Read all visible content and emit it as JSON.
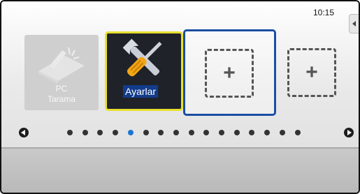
{
  "status_bar": {
    "time": "10:15"
  },
  "tiles": [
    {
      "id": "pc-scan",
      "label_lines": [
        "PC",
        "Tarama"
      ],
      "state": "disabled",
      "icon": "scanner-icon"
    },
    {
      "id": "settings",
      "label": "Ayarlar",
      "state": "highlighted",
      "icon": "wrench-screwdriver-icon"
    },
    {
      "id": "add-1",
      "label": "+",
      "state": "selected",
      "icon": "plus-icon"
    },
    {
      "id": "add-2",
      "label": "+",
      "state": "normal",
      "icon": "plus-icon"
    }
  ],
  "pager": {
    "total_pages": 16,
    "current_page": 5
  },
  "colors": {
    "highlight_border": "#e8e02f",
    "selected_border": "#1a4fa3",
    "active_dot": "#1c76d2",
    "label_background": "#123b8a"
  }
}
